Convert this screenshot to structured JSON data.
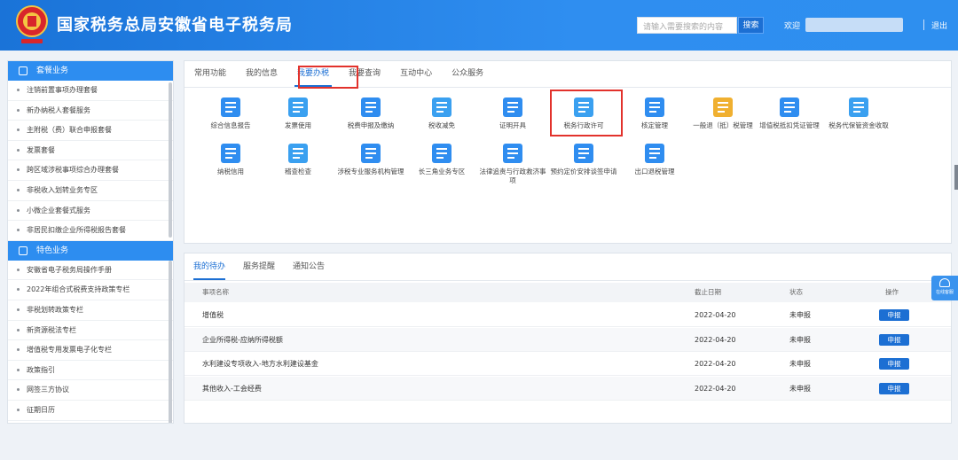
{
  "header": {
    "title": "国家税务总局安徽省电子税务局",
    "search_placeholder": "请输入需要搜索的内容",
    "search_button": "搜索",
    "welcome": "欢迎",
    "logout": "退出"
  },
  "sidebar": {
    "section1": "套餐业务",
    "section1_items": [
      "注销前置事项办理套餐",
      "新办纳税人套餐服务",
      "主附税（费）联合申报套餐",
      "发票套餐",
      "跨区域涉税事项综合办理套餐",
      "非税收入划转业务专区",
      "小微企业套餐式服务",
      "非居民扣缴企业所得税报告套餐"
    ],
    "section2": "特色业务",
    "section2_items": [
      "安徽省电子税务局操作手册",
      "2022年组合式税费支持政策专栏",
      "非税划转政策专栏",
      "新资源税法专栏",
      "增值税专用发票电子化专栏",
      "政策指引",
      "网签三方协议",
      "征期日历"
    ]
  },
  "main_tabs": [
    "常用功能",
    "我的信息",
    "我要办税",
    "我要查询",
    "互动中心",
    "公众服务"
  ],
  "active_tab": "我要办税",
  "functions": [
    {
      "label": "综合信息报告",
      "icon": "report-icon",
      "color": "#2f8df0"
    },
    {
      "label": "发票使用",
      "icon": "invoice-icon",
      "color": "#3aa0f0"
    },
    {
      "label": "税费申报及缴纳",
      "icon": "tax-declare-icon",
      "color": "#2f8df0"
    },
    {
      "label": "税收减免",
      "icon": "tax-reduction-icon",
      "color": "#3aa0f0"
    },
    {
      "label": "证明开具",
      "icon": "certificate-icon",
      "color": "#2f8df0"
    },
    {
      "label": "税务行政许可",
      "icon": "admin-license-icon",
      "color": "#3aa0f0"
    },
    {
      "label": "核定管理",
      "icon": "verify-icon",
      "color": "#2f8df0"
    },
    {
      "label": "一般退（抵）税管理",
      "icon": "refund-icon",
      "color": "#f0b030"
    },
    {
      "label": "增值税抵扣凭证管理",
      "icon": "vat-deduct-icon",
      "color": "#2f8df0"
    },
    {
      "label": "税务代保管资金收取",
      "icon": "custody-icon",
      "color": "#3aa0f0"
    },
    {
      "label": "纳税信用",
      "icon": "credit-icon",
      "color": "#2f8df0"
    },
    {
      "label": "稽查检查",
      "icon": "inspection-icon",
      "color": "#3aa0f0"
    },
    {
      "label": "涉税专业服务机构管理",
      "icon": "agency-icon",
      "color": "#2f8df0"
    },
    {
      "label": "长三角业务专区",
      "icon": "yangtze-icon",
      "color": "#2f8df0"
    },
    {
      "label": "法律追责与行政救济事项",
      "icon": "legal-icon",
      "color": "#2f8df0"
    },
    {
      "label": "预约定价安排谈签申请",
      "icon": "pricing-icon",
      "color": "#2f8df0"
    },
    {
      "label": "出口退税管理",
      "icon": "export-refund-icon",
      "color": "#2f8df0"
    }
  ],
  "lower_tabs": [
    "我的待办",
    "服务提醒",
    "通知公告"
  ],
  "table": {
    "headers": [
      "事项名称",
      "截止日期",
      "状态",
      "操作"
    ],
    "rows": [
      {
        "name": "增值税",
        "date": "2022-04-20",
        "status": "未申报",
        "action": "申报"
      },
      {
        "name": "企业所得税-应纳所得税额",
        "date": "2022-04-20",
        "status": "未申报",
        "action": "申报"
      },
      {
        "name": "水利建设专项收入-地方水利建设基金",
        "date": "2022-04-20",
        "status": "未申报",
        "action": "申报"
      },
      {
        "name": "其他收入-工会经费",
        "date": "2022-04-20",
        "status": "未申报",
        "action": "申报"
      }
    ]
  },
  "float_help": "在线客服"
}
